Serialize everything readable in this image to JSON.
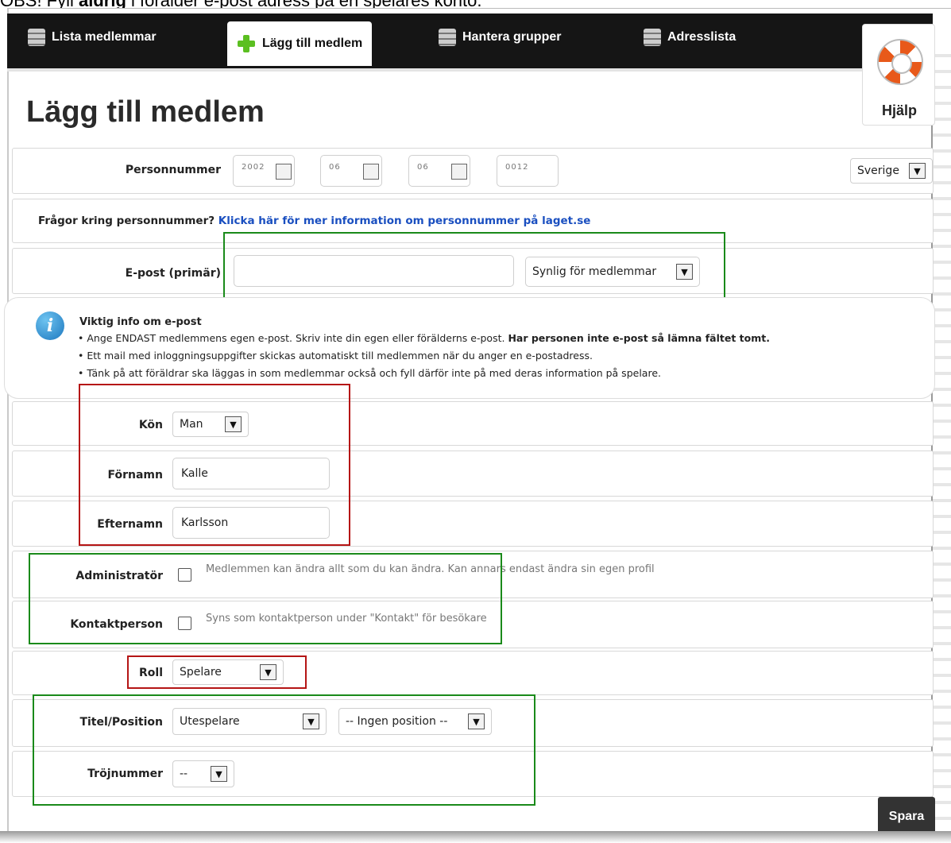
{
  "caption": {
    "prefix": "OBS! Fyll ",
    "emphasis": "aldrig",
    "suffix": " i förälder e-post adress på en spelares konto."
  },
  "nav": {
    "tabs": [
      {
        "label": "Lista medlemmar",
        "icon": "list-icon"
      },
      {
        "label": "Lägg till medlem",
        "icon": "plus-icon"
      },
      {
        "label": "Hantera grupper",
        "icon": "list-icon"
      },
      {
        "label": "Adresslista",
        "icon": "list-icon"
      }
    ],
    "active_tab": "Lägg till medlem"
  },
  "help": {
    "label": "Hjälp",
    "icon": "lifebuoy-icon"
  },
  "page_title": "Lägg till medlem",
  "personnummer": {
    "label": "Personnummer",
    "parts": [
      "2002",
      "06",
      "06",
      "0012"
    ],
    "country": "Sverige"
  },
  "pn_question": {
    "text": "Frågor kring personnummer?",
    "link": "Klicka här för mer information om personnummer på laget.se"
  },
  "email": {
    "label": "E-post (primär)",
    "value": "",
    "visibility": "Synlig för medlemmar"
  },
  "info": {
    "title": "Viktig info om e-post",
    "line1_normal": "• Ange ENDAST medlemmens egen e-post. Skriv inte din egen eller förälderns e-post. ",
    "line1_bold": "Har personen inte e-post så lämna fältet tomt.",
    "line2": "• Ett mail med inloggningsuppgifter skickas automatiskt till medlemmen när du anger en e-postadress.",
    "line3": "• Tänk på att föräldrar ska läggas in som medlemmar också och fyll därför inte på med deras information på spelare."
  },
  "gender": {
    "label": "Kön",
    "value": "Man"
  },
  "firstname": {
    "label": "Förnamn",
    "value": "Kalle"
  },
  "lastname": {
    "label": "Efternamn",
    "value": "Karlsson"
  },
  "admin": {
    "label": "Administratör",
    "checked": false,
    "desc": "Medlemmen kan ändra allt som du kan ändra. Kan annars endast ändra sin egen profil"
  },
  "contact": {
    "label": "Kontaktperson",
    "checked": false,
    "desc": "Syns som kontaktperson under \"Kontakt\" för besökare"
  },
  "role": {
    "label": "Roll",
    "value": "Spelare"
  },
  "title_position": {
    "label": "Titel/Position",
    "title": "Utespelare",
    "position": "-- Ingen position --"
  },
  "jersey": {
    "label": "Tröjnummer",
    "value": "--"
  },
  "save_label": "Spara",
  "colors": {
    "nav_bg": "#151515",
    "link": "#1a4fc0",
    "green_box": "#1a8a1a",
    "red_box": "#b51515",
    "plus": "#5bbf21",
    "lifebuoy": "#e8591a"
  }
}
